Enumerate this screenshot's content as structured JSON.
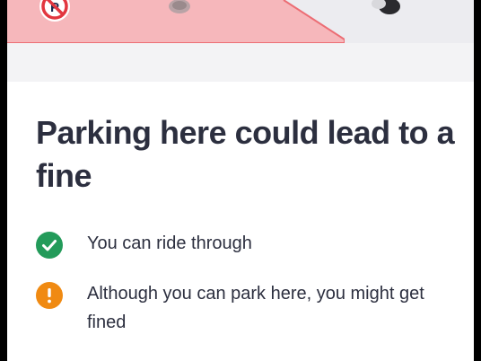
{
  "illustration": {
    "no_parking_sign_icon": "no-parking-icon",
    "restricted_zone_color": "#f6b7bb",
    "restricted_zone_border": "#ec6d74"
  },
  "content": {
    "title": "Parking here could lead to a fine",
    "rules": [
      {
        "icon": "check-circle-icon",
        "color": "#239b5a",
        "text": "You can ride through"
      },
      {
        "icon": "warning-circle-icon",
        "color": "#f08a12",
        "text": "Although you can park here, you might get fined"
      }
    ]
  }
}
